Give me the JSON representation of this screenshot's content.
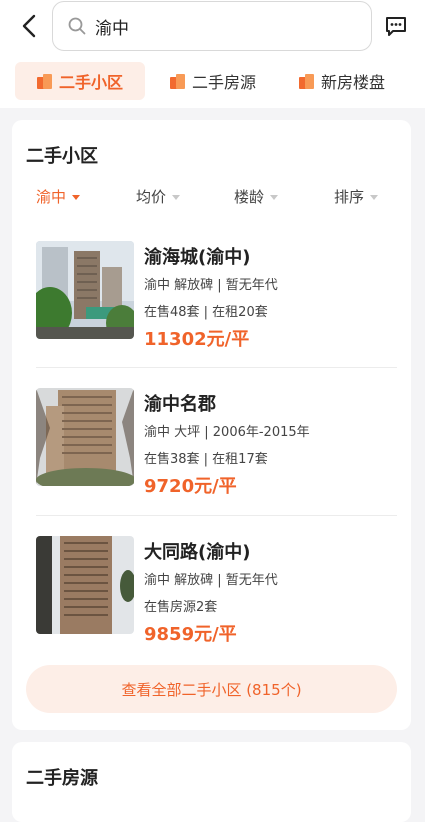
{
  "header": {
    "search_value": "渝中",
    "back_icon": "back-arrow-icon",
    "search_icon": "search-icon",
    "message_icon": "message-icon"
  },
  "tabs": [
    {
      "label": "二手小区",
      "active": true
    },
    {
      "label": "二手房源",
      "active": false
    },
    {
      "label": "新房楼盘",
      "active": false
    }
  ],
  "section1": {
    "title": "二手小区",
    "filters": [
      {
        "label": "渝中",
        "active": true
      },
      {
        "label": "均价",
        "active": false
      },
      {
        "label": "楼龄",
        "active": false
      },
      {
        "label": "排序",
        "active": false
      }
    ],
    "listings": [
      {
        "name": "渝海城(渝中)",
        "meta": "渝中 解放碑 | 暂无年代",
        "meta2": "在售48套 | 在租20套",
        "price": "11302元/平"
      },
      {
        "name": "渝中名郡",
        "meta": "渝中 大坪 | 2006年-2015年",
        "meta2": "在售38套 | 在租17套",
        "price": "9720元/平"
      },
      {
        "name": "大同路(渝中)",
        "meta": "渝中 解放碑 | 暂无年代",
        "meta2": "在售房源2套",
        "price": "9859元/平"
      }
    ],
    "view_all": "查看全部二手小区 (815个)"
  },
  "section2": {
    "title": "二手房源"
  },
  "colors": {
    "accent": "#f0632a",
    "accent_bg": "#fdeee7",
    "page_bg": "#f4f4f6"
  }
}
